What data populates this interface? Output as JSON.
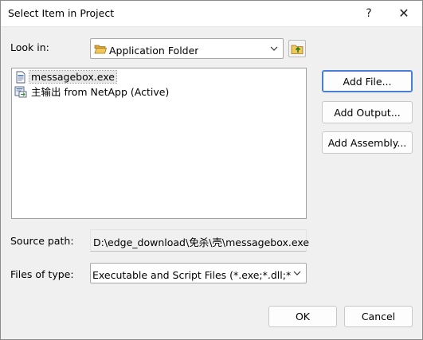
{
  "window": {
    "title": "Select Item in Project",
    "help_glyph": "?",
    "close_glyph": "✕"
  },
  "look_in": {
    "label": "Look in:",
    "value": "Application Folder"
  },
  "list": {
    "items": [
      {
        "label": "messagebox.exe",
        "icon": "exe-file-icon",
        "selected": true
      },
      {
        "label": "主输出 from NetApp (Active)",
        "icon": "project-output-icon",
        "selected": false
      }
    ]
  },
  "buttons": {
    "add_file": "Add File...",
    "add_output": "Add Output...",
    "add_assembly": "Add Assembly...",
    "ok": "OK",
    "cancel": "Cancel"
  },
  "source_path": {
    "label": "Source path:",
    "value": "D:\\edge_download\\免杀\\壳\\messagebox.exe"
  },
  "files_of_type": {
    "label": "Files of type:",
    "value": "Executable and Script Files (*.exe;*.dll;*.vbs;"
  },
  "colors": {
    "accent_border": "#4a7ed6",
    "folder_yellow": "#e8b33c"
  }
}
